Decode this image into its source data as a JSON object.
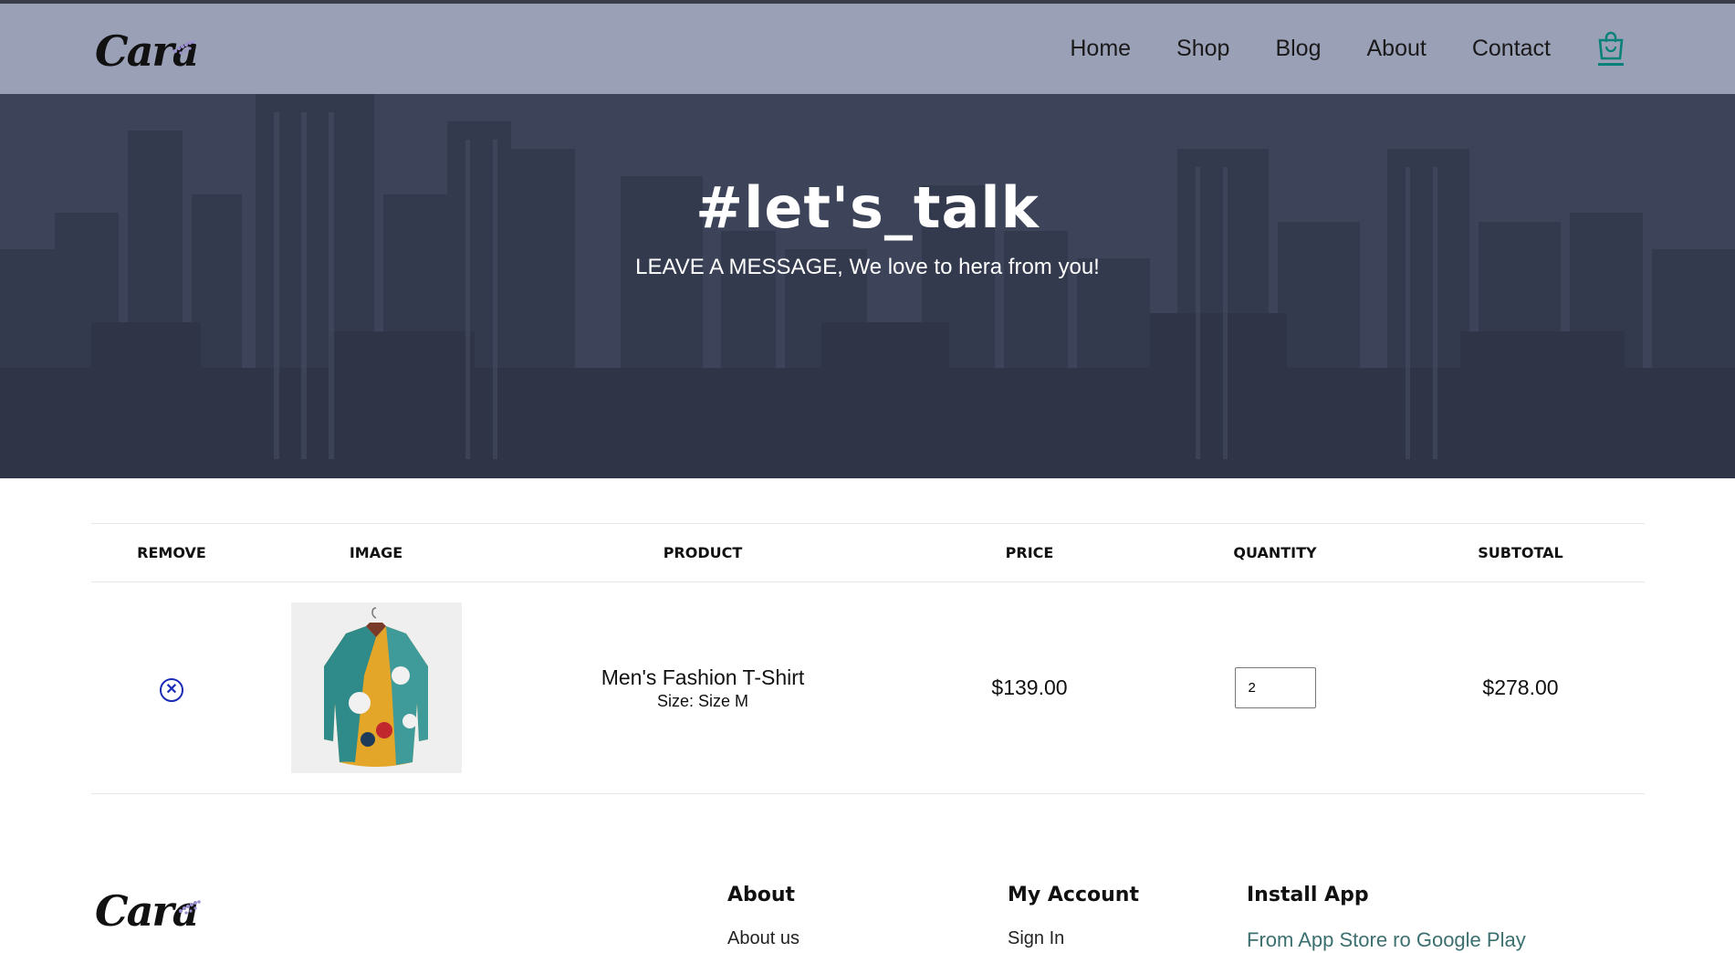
{
  "brand": {
    "logo_text": "Cara"
  },
  "nav": {
    "items": [
      {
        "label": "Home"
      },
      {
        "label": "Shop"
      },
      {
        "label": "Blog"
      },
      {
        "label": "About"
      },
      {
        "label": "Contact"
      }
    ],
    "cart_icon": "shopping-bag-icon",
    "cart_icon_color": "#088178"
  },
  "hero": {
    "title": "#let's_talk",
    "subtitle": "LEAVE A MESSAGE, We love to hera from you!"
  },
  "cart": {
    "headers": [
      "REMOVE",
      "IMAGE",
      "PRODUCT",
      "PRICE",
      "QUANTITY",
      "SUBTOTAL"
    ],
    "rows": [
      {
        "remove_icon": "close-circle-icon",
        "image_icon": "shirt-icon",
        "product_name": "Men's Fashion T-Shirt",
        "product_size": "Size: Size M",
        "price": "$139.00",
        "quantity": "2",
        "subtotal": "$278.00"
      }
    ],
    "remove_color": "#1a2bb8"
  },
  "footer": {
    "logo_text": "Cara",
    "about": {
      "heading": "About",
      "link": "About us"
    },
    "account": {
      "heading": "My Account",
      "link": "Sign In"
    },
    "app": {
      "heading": "Install App",
      "text": "From App Store ro Google Play"
    }
  }
}
